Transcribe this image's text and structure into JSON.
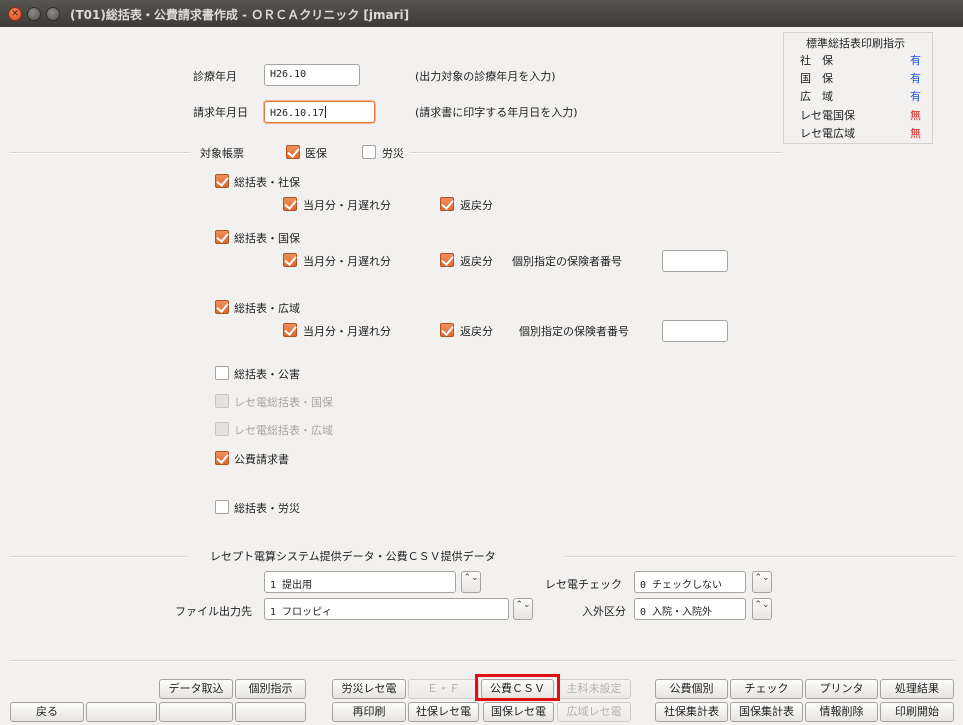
{
  "window": {
    "title": "(T01)総括表・公費請求書作成 - ＯＲＣＡクリニック [jmari]"
  },
  "header": {
    "date_label": "診療年月",
    "date_value": "H26.10",
    "date_note": "(出力対象の診療年月を入力)",
    "bill_label": "請求年月日",
    "bill_value": "H26.10.17",
    "bill_note": "(請求書に印字する年月日を入力)"
  },
  "standard_panel": {
    "title": "標準総括表印刷指示",
    "rows": [
      {
        "label": "社　保",
        "value": "有",
        "color": "#2255dd"
      },
      {
        "label": "国　保",
        "value": "有",
        "color": "#2255dd"
      },
      {
        "label": "広　域",
        "value": "有",
        "color": "#2255dd"
      },
      {
        "label": "レセ電国保",
        "value": "無",
        "color": "#e03030"
      },
      {
        "label": "レセ電広域",
        "value": "無",
        "color": "#e03030"
      }
    ]
  },
  "target": {
    "label": "対象帳票",
    "ikuho": {
      "label": "医保",
      "checked": true
    },
    "rousai": {
      "label": "労災",
      "checked": false
    }
  },
  "sections": {
    "shaho": {
      "label": "総括表・社保",
      "checked": true,
      "current": "当月分・月遅れ分",
      "return": "返戻分"
    },
    "kokuho": {
      "label": "総括表・国保",
      "checked": true,
      "current": "当月分・月遅れ分",
      "return": "返戻分",
      "insurer_label": "個別指定の保険者番号",
      "insurer_value": ""
    },
    "kouiki": {
      "label": "総括表・広域",
      "checked": true,
      "current": "当月分・月遅れ分",
      "return": "返戻分",
      "insurer_label": "個別指定の保険者番号",
      "insurer_value": ""
    },
    "kougai": {
      "label": "総括表・公害",
      "checked": false
    },
    "rece_kokuho": {
      "label": "レセ電総括表・国保",
      "disabled": true
    },
    "rece_kouiki": {
      "label": "レセ電総括表・広域",
      "disabled": true
    },
    "kouhi": {
      "label": "公費請求書",
      "checked": true
    },
    "rousai": {
      "label": "総括表・労災",
      "checked": false
    }
  },
  "receipt": {
    "title": "レセプト電算システム提供データ・公費ＣＳＶ提供データ",
    "mode_value": "1 提出用",
    "check_label": "レセ電チェック",
    "check_value": "0 チェックしない",
    "output_label": "ファイル出力先",
    "output_value": "1 フロッピィ",
    "inout_label": "入外区分",
    "inout_value": "0 入院・入院外"
  },
  "footer": {
    "row1": {
      "data_import": "データ取込",
      "individual": "個別指示",
      "rousai_rece": "労災レセ電",
      "ef": "Ｅ・Ｆ",
      "kouhi_csv": "公費ＣＳＶ",
      "dept_unset": "主科未設定",
      "kouhi_individual": "公費個別",
      "check": "チェック",
      "printer": "プリンタ",
      "result": "処理結果"
    },
    "row2": {
      "back": "戻る",
      "reprint": "再印刷",
      "shaho_rece": "社保レセ電",
      "kokuho_rece": "国保レセ電",
      "kouiki_rece": "広域レセ電",
      "shaho_total": "社保集計表",
      "kokuho_total": "国保集計表",
      "info_delete": "情報削除",
      "print_start": "印刷開始"
    }
  },
  "spinner_glyph": "⌃⌄"
}
